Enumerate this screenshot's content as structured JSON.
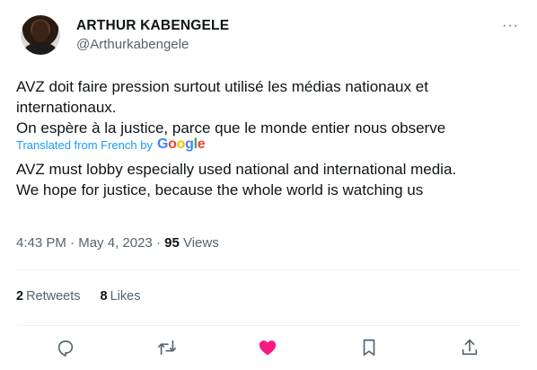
{
  "tweet": {
    "author_name": "ARTHUR KABENGELE",
    "handle": "@Arthurkabengele",
    "more_label": "···",
    "original_line1": "AVZ doit faire pression surtout utilisé les médias nationaux et internationaux.",
    "original_line2": "On espère à la justice,  parce que le monde entier nous observe",
    "translated_from": "Translated from French by",
    "google_letters": [
      "G",
      "o",
      "o",
      "g",
      "l",
      "e"
    ],
    "translation_line1": "AVZ must lobby especially used national and international media.",
    "translation_line2": "We hope for justice, because the whole world is watching us",
    "time": "4:43 PM",
    "date": "May 4, 2023",
    "separator": "·",
    "views_count": "95",
    "views_label": "Views"
  },
  "stats": {
    "retweets_count": "2",
    "retweets_label": "Retweets",
    "likes_count": "8",
    "likes_label": "Likes"
  },
  "actions": {
    "icons": [
      "reply-icon",
      "retweet-icon",
      "like-icon",
      "bookmark-icon",
      "share-icon"
    ]
  },
  "colors": {
    "text": "#0f1419",
    "secondary": "#536471",
    "link": "#1d9bf0",
    "like_active": "#f91880",
    "divider": "#eff3f4"
  }
}
